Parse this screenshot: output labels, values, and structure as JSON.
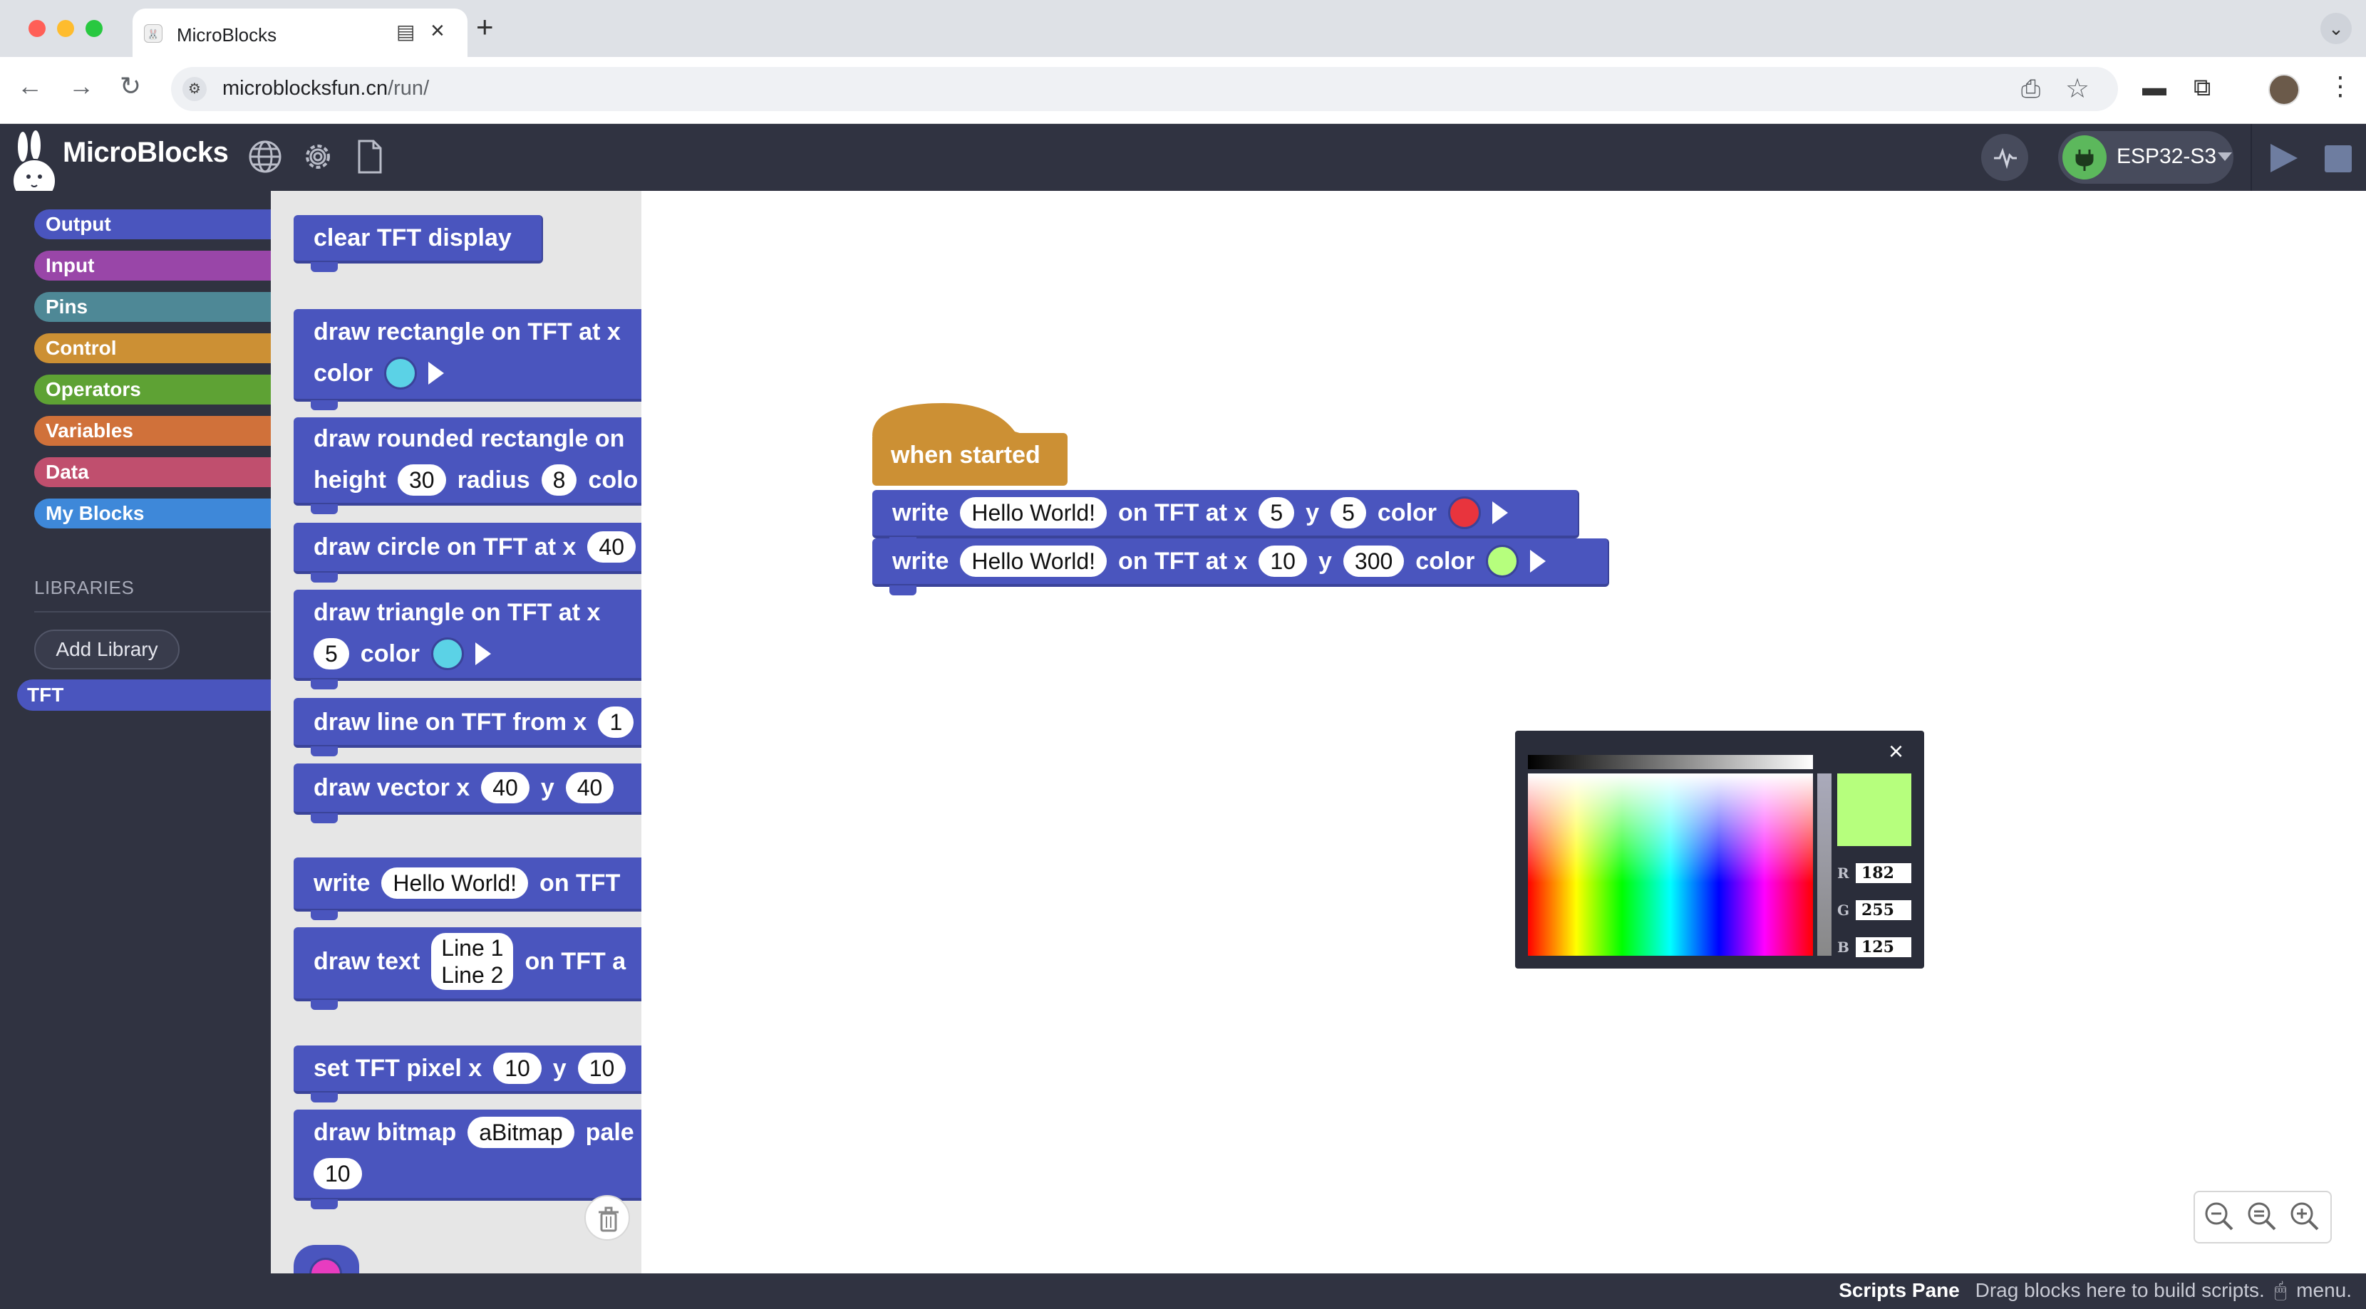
{
  "browser": {
    "tab_title": "MicroBlocks",
    "url_host": "microblocksfun.cn",
    "url_path": "/run/"
  },
  "app": {
    "title": "MicroBlocks",
    "board_name": "ESP32-S3",
    "colors": {
      "topbar": "#303341",
      "sidebar": "#303341",
      "board_connected": "#5cb85c"
    }
  },
  "categories": [
    {
      "label": "Output",
      "color": "#4a55be"
    },
    {
      "label": "Input",
      "color": "#9946a8"
    },
    {
      "label": "Pins",
      "color": "#4e8896"
    },
    {
      "label": "Control",
      "color": "#cc9034"
    },
    {
      "label": "Operators",
      "color": "#5ea234"
    },
    {
      "label": "Variables",
      "color": "#d0713a"
    },
    {
      "label": "Data",
      "color": "#c04f6e"
    },
    {
      "label": "My Blocks",
      "color": "#3e88d9"
    }
  ],
  "libraries": {
    "heading": "LIBRARIES",
    "add_button": "Add Library",
    "items": [
      "TFT"
    ]
  },
  "palette": {
    "clear": "clear TFT display",
    "rect_l1": "draw rectangle on TFT at x",
    "rect_color": "color",
    "rrect_l1": "draw rounded rectangle on",
    "rrect_height": "height",
    "rrect_height_val": "30",
    "rrect_radius": "radius",
    "rrect_radius_val": "8",
    "rrect_color": "colo",
    "circle": "draw circle on TFT at x",
    "circle_x": "40",
    "triangle": "draw triangle on TFT at x",
    "triangle_val": "5",
    "triangle_color": "color",
    "line": "draw line on TFT from x",
    "line_x": "1",
    "vector": "draw vector x",
    "vector_x": "40",
    "vector_y_label": "y",
    "vector_y": "40",
    "write": "write",
    "write_text": "Hello World!",
    "write_on": "on TFT",
    "text": "draw text",
    "text_line1": "Line 1",
    "text_line2": "Line 2",
    "text_on": "on TFT a",
    "pixel": "set TFT pixel x",
    "pixel_x": "10",
    "pixel_y_label": "y",
    "pixel_y": "10",
    "bitmap": "draw bitmap",
    "bitmap_name": "aBitmap",
    "bitmap_pale": "pale",
    "bitmap_val": "10"
  },
  "script": {
    "hat": "when started",
    "write1": {
      "label": "write",
      "text": "Hello World!",
      "on": "on TFT at x",
      "x": "5",
      "y_label": "y",
      "y": "5",
      "color_label": "color",
      "color": "#e8343d"
    },
    "write2": {
      "label": "write",
      "text": "Hello World!",
      "on": "on TFT at x",
      "x": "10",
      "y_label": "y",
      "y": "300",
      "color_label": "color",
      "color": "#b6ff7d"
    }
  },
  "color_picker": {
    "r_label": "R",
    "r": "182",
    "g_label": "G",
    "g": "255",
    "b_label": "B",
    "b": "125",
    "preview_color": "#b6ff7d"
  },
  "status": {
    "title": "Scripts Pane",
    "hint": "Drag blocks here to build scripts.",
    "menu": "menu."
  }
}
